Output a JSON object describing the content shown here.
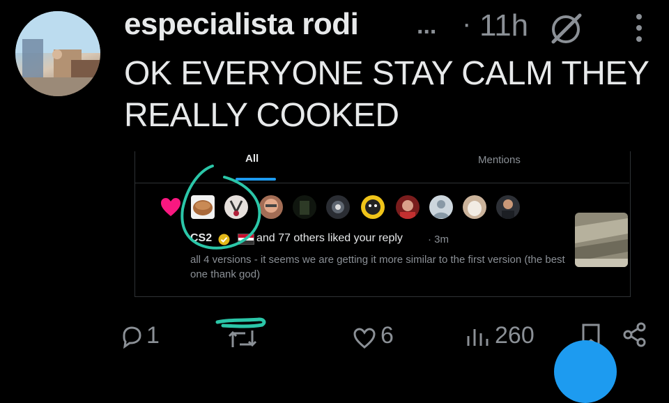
{
  "post": {
    "author_name": "especialista rodi",
    "name_ellipsis": "...",
    "dot": "·",
    "time": "11h",
    "text": "OK EVERYONE STAY CALM THEY REALLY COOKED"
  },
  "embed": {
    "tabs": [
      {
        "label": "All",
        "active": true
      },
      {
        "label": "Mentions",
        "active": false
      }
    ],
    "liker_name": "CS2",
    "others_text": "and 77 others liked your reply",
    "time_text": "· 3m",
    "reply_text": "all 4 versions - it seems we are getting it more similar to the first version (the best one thank god)",
    "accent_color": "#1d9bf0",
    "heart_color": "#f91880"
  },
  "actions": {
    "replies": "1",
    "likes": "6",
    "views": "260"
  }
}
